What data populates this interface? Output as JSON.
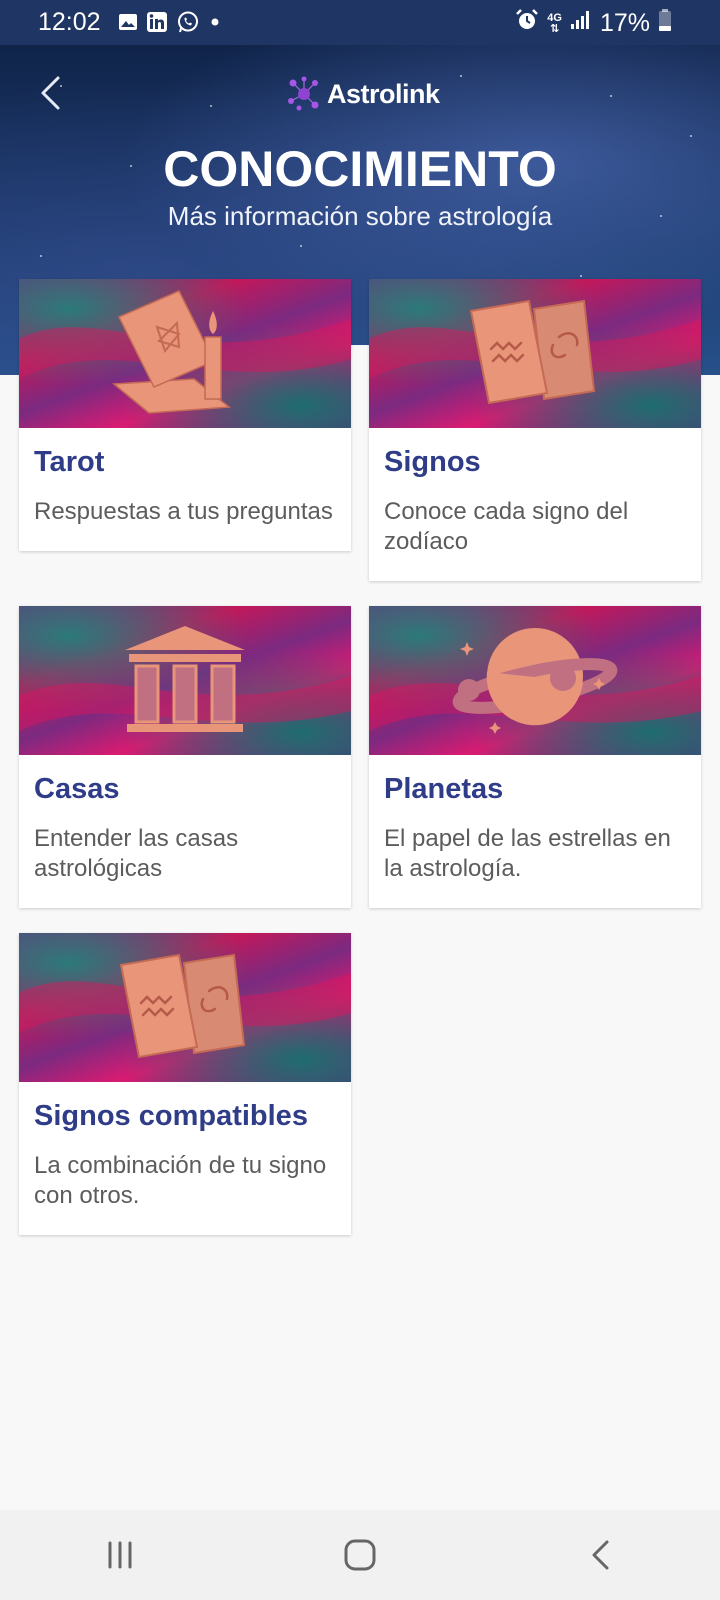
{
  "status_bar": {
    "time": "12:02",
    "battery": "17%",
    "network": "4G",
    "left_icons": [
      "image-icon",
      "linkedin-icon",
      "whatsapp-icon",
      "dot-icon"
    ],
    "right_icons": [
      "alarm-icon",
      "network-4g-icon",
      "signal-icon",
      "battery-icon"
    ]
  },
  "header": {
    "logo_text": "Astrolink",
    "title": "CONOCIMIENTO",
    "subtitle": "Más información sobre astrología"
  },
  "cards": [
    {
      "title": "Tarot",
      "description": "Respuestas a tus preguntas",
      "icon": "tarot-cards-candle-icon"
    },
    {
      "title": "Signos",
      "description": "Conoce cada signo del zodíaco",
      "icon": "zodiac-cards-icon"
    },
    {
      "title": "Casas",
      "description": "Entender las casas astrológicas",
      "icon": "temple-icon"
    },
    {
      "title": "Planetas",
      "description": "El papel de las estrellas en la astrología.",
      "icon": "planet-icon"
    },
    {
      "title": "Signos compatibles",
      "description": "La combinación de tu signo con otros.",
      "icon": "zodiac-cards-icon"
    }
  ],
  "nav_bar": {
    "buttons": [
      "recent-apps-icon",
      "home-icon",
      "back-icon"
    ]
  },
  "colors": {
    "status_bar": "#1f3563",
    "card_title": "#2f3c87",
    "card_text": "#5c5c5c",
    "illustration": "#e8957a",
    "background": "#f8f8f8"
  }
}
